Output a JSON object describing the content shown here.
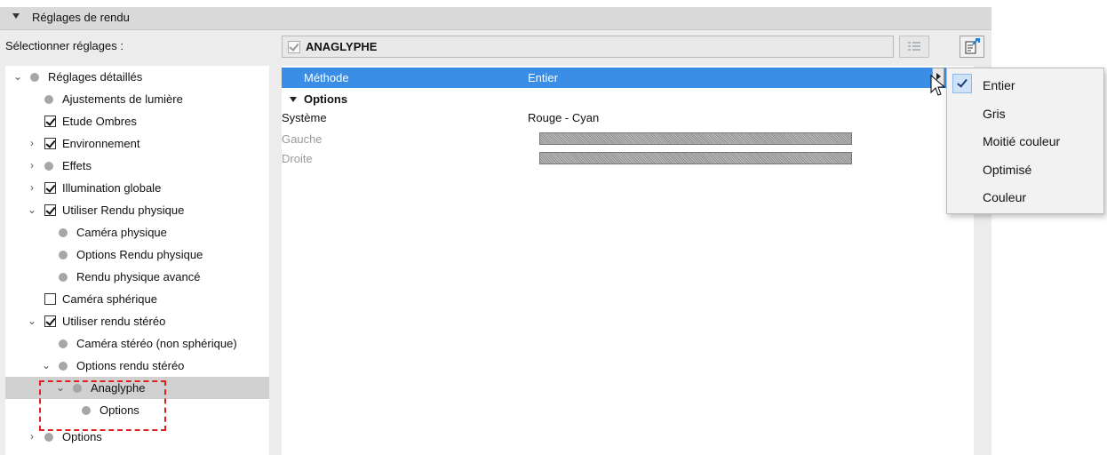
{
  "header": {
    "title": "Réglages de rendu"
  },
  "left": {
    "select_label": "Sélectionner réglages :",
    "tree": [
      {
        "label": "Réglages détaillés",
        "type": "bullet",
        "expander": "open"
      },
      {
        "label": "Ajustements de lumière",
        "type": "bullet",
        "expander": "none"
      },
      {
        "label": "Etude Ombres",
        "type": "checkbox",
        "checked": true,
        "expander": "none"
      },
      {
        "label": "Environnement",
        "type": "checkbox",
        "checked": true,
        "expander": "closed"
      },
      {
        "label": "Effets",
        "type": "bullet",
        "expander": "closed"
      },
      {
        "label": "Illumination globale",
        "type": "checkbox",
        "checked": true,
        "expander": "closed"
      },
      {
        "label": "Utiliser Rendu physique",
        "type": "checkbox",
        "checked": true,
        "expander": "open"
      },
      {
        "label": "Caméra physique",
        "type": "bullet",
        "expander": "none"
      },
      {
        "label": "Options Rendu physique",
        "type": "bullet",
        "expander": "none"
      },
      {
        "label": "Rendu physique avancé",
        "type": "bullet",
        "expander": "none"
      },
      {
        "label": "Caméra sphérique",
        "type": "checkbox",
        "checked": false,
        "expander": "none"
      },
      {
        "label": "Utiliser rendu stéréo",
        "type": "checkbox",
        "checked": true,
        "expander": "open"
      },
      {
        "label": "Caméra stéréo (non sphérique)",
        "type": "bullet",
        "expander": "none"
      },
      {
        "label": "Options rendu stéréo",
        "type": "bullet",
        "expander": "open"
      },
      {
        "label": "Anaglyphe",
        "type": "bullet",
        "expander": "open",
        "selected": true
      },
      {
        "label": "Options",
        "type": "bullet",
        "expander": "none"
      },
      {
        "label": "Options",
        "type": "bullet",
        "expander": "closed"
      }
    ]
  },
  "right": {
    "title": "ANAGLYPHE",
    "properties": {
      "methode": {
        "label": "Méthode",
        "value": "Entier"
      },
      "options_section": "Options",
      "systeme": {
        "label": "Système",
        "value": "Rouge - Cyan"
      },
      "gauche": {
        "label": "Gauche"
      },
      "droite": {
        "label": "Droite"
      }
    }
  },
  "menu": {
    "items": [
      "Entier",
      "Gris",
      "Moitié couleur",
      "Optimisé",
      "Couleur"
    ],
    "checked": "Entier"
  },
  "colors": {
    "highlight": "#3a8ee6",
    "selection_box": "#e02020"
  }
}
